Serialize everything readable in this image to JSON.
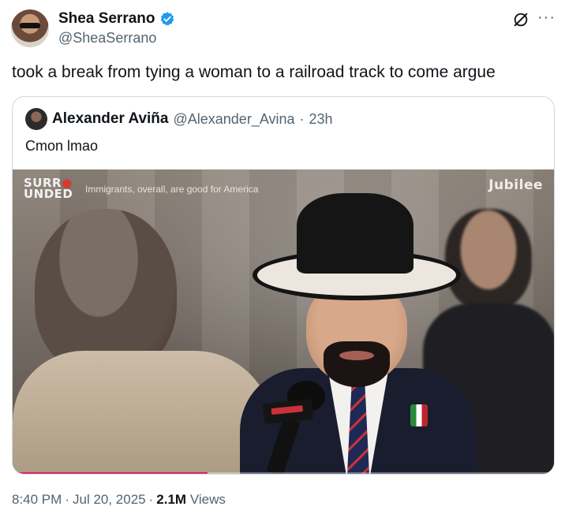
{
  "author": {
    "name": "Shea Serrano",
    "handle": "@SheaSerrano"
  },
  "tweet": {
    "text": "took a break from tying a woman to a railroad track to come argue"
  },
  "quote": {
    "name": "Alexander Aviña",
    "handle": "@Alexander_Avina",
    "separator": "·",
    "age": "23h",
    "text": "Cmon lmao",
    "media": {
      "brand_line1": "SURR",
      "brand_dot": "●",
      "brand_line2": "UNDED",
      "caption": "Immigrants, overall, are good for America",
      "channel": "Jubilee",
      "progress": 0.36
    }
  },
  "meta": {
    "time": "8:40 PM",
    "sep1": "·",
    "date": "Jul 20, 2025",
    "sep2": "·",
    "views_count": "2.1M",
    "views_label": "Views"
  },
  "icons": {
    "verified": "verified-badge-icon",
    "grok": "grok-icon",
    "more": "more-icon"
  },
  "colors": {
    "verified": "#1d9bf0",
    "secondary_text": "#536471",
    "progress": "#e0245e"
  }
}
